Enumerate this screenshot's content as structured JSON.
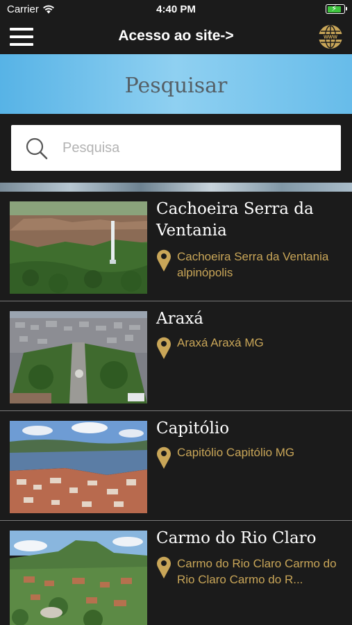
{
  "status_bar": {
    "carrier": "Carrier",
    "time": "4:40 PM"
  },
  "nav": {
    "title": "Acesso ao site->",
    "menu_icon": "hamburger-menu-icon",
    "globe_icon": "www-globe-icon"
  },
  "search_header": {
    "title": "Pesquisar"
  },
  "search": {
    "placeholder": "Pesquisa",
    "value": ""
  },
  "colors": {
    "background": "#1b1b1b",
    "accent_gold": "#c9a658",
    "header_blue": "#6ec1ec"
  },
  "items": [
    {
      "title": "Cachoeira Serra da Ventania",
      "location": "Cachoeira Serra da Ventania alpinópolis"
    },
    {
      "title": "Araxá",
      "location": "Araxá Araxá MG"
    },
    {
      "title": "Capitólio",
      "location": "Capitólio Capitólio MG"
    },
    {
      "title": "Carmo do Rio Claro",
      "location": "Carmo do Rio Claro Carmo do Rio Claro Carmo do R..."
    }
  ]
}
